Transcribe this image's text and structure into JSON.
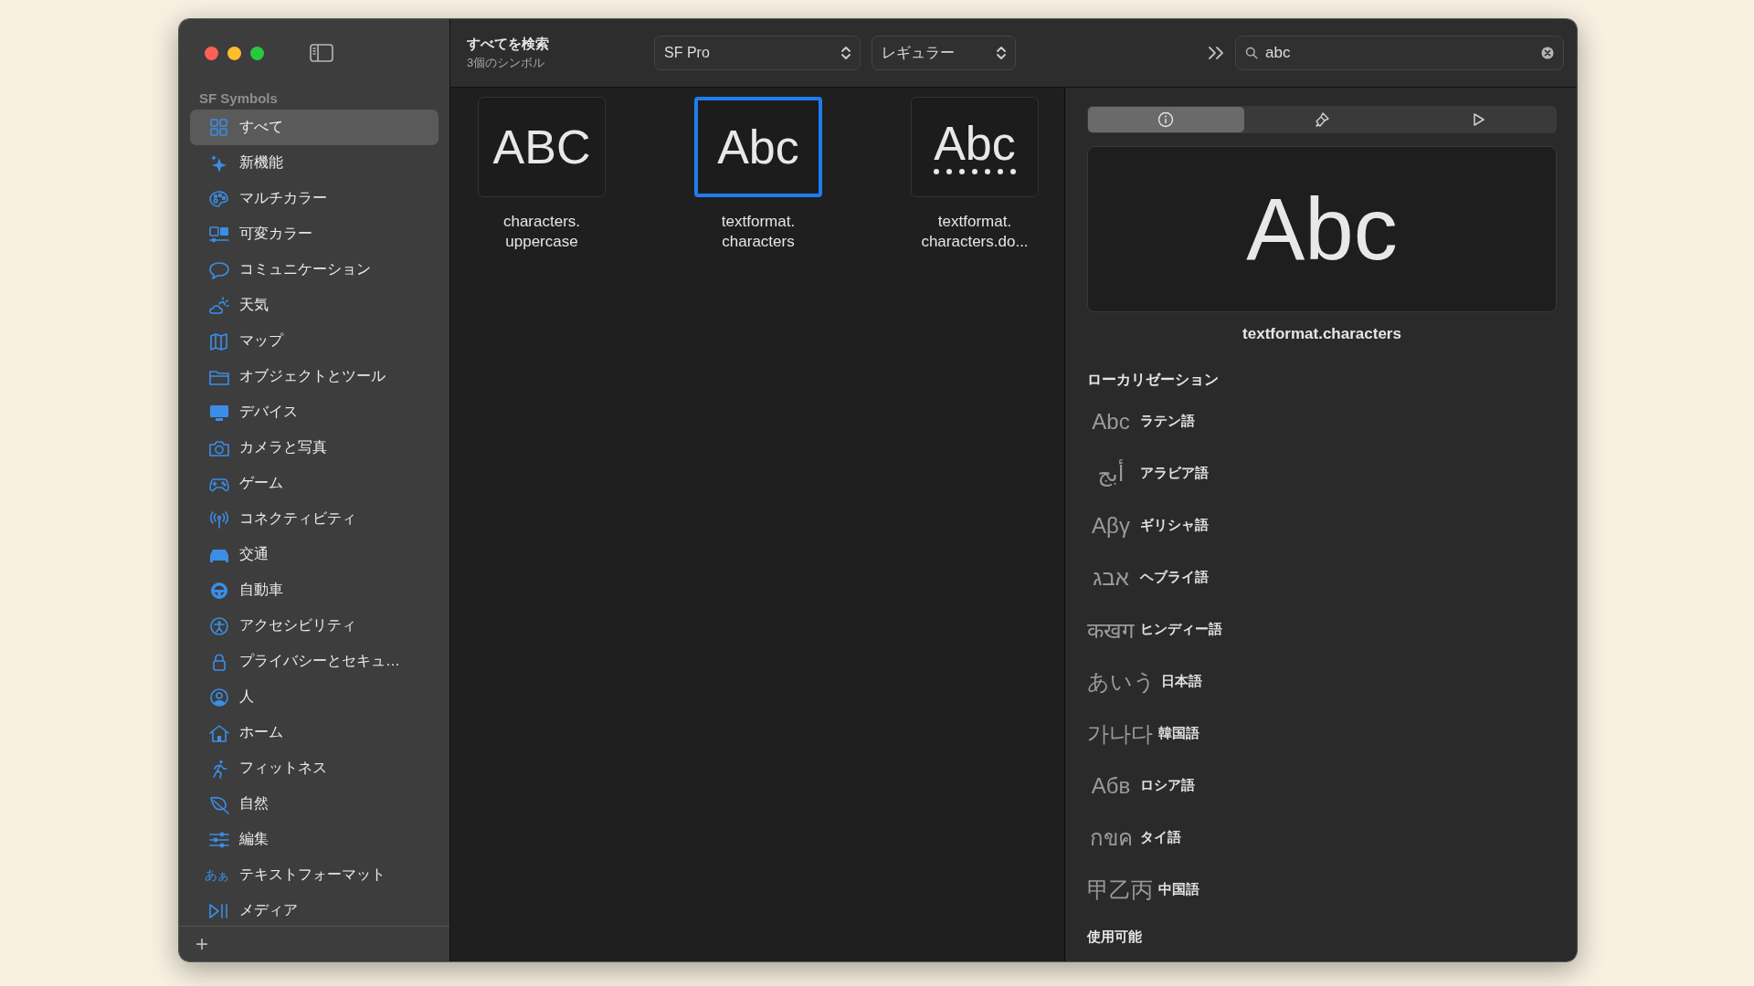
{
  "window": {
    "title": "すべてを検索",
    "subtitle": "3個のシンボル"
  },
  "sidebar": {
    "heading": "SF Symbols",
    "items": [
      {
        "label": "すべて",
        "selected": true
      },
      {
        "label": "新機能",
        "selected": false
      },
      {
        "label": "マルチカラー",
        "selected": false
      },
      {
        "label": "可変カラー",
        "selected": false
      },
      {
        "label": "コミュニケーション",
        "selected": false
      },
      {
        "label": "天気",
        "selected": false
      },
      {
        "label": "マップ",
        "selected": false
      },
      {
        "label": "オブジェクトとツール",
        "selected": false
      },
      {
        "label": "デバイス",
        "selected": false
      },
      {
        "label": "カメラと写真",
        "selected": false
      },
      {
        "label": "ゲーム",
        "selected": false
      },
      {
        "label": "コネクティビティ",
        "selected": false
      },
      {
        "label": "交通",
        "selected": false
      },
      {
        "label": "自動車",
        "selected": false
      },
      {
        "label": "アクセシビリティ",
        "selected": false
      },
      {
        "label": "プライバシーとセキュ…",
        "selected": false
      },
      {
        "label": "人",
        "selected": false
      },
      {
        "label": "ホーム",
        "selected": false
      },
      {
        "label": "フィットネス",
        "selected": false
      },
      {
        "label": "自然",
        "selected": false
      },
      {
        "label": "編集",
        "selected": false
      },
      {
        "label": "テキストフォーマット",
        "selected": false,
        "icon_text": "あぁ"
      },
      {
        "label": "メディア",
        "selected": false
      }
    ],
    "add_button": "+"
  },
  "toolbar": {
    "font_popup": "SF Pro",
    "weight_popup": "レギュラー",
    "search": {
      "value": "abc"
    }
  },
  "symbols": [
    {
      "glyph": "ABC",
      "kind": "plain",
      "name": "characters.\nuppercase",
      "selected": false
    },
    {
      "glyph": "Abc",
      "kind": "plain",
      "name": "textformat.\ncharacters",
      "selected": true
    },
    {
      "glyph": "Abc",
      "kind": "dotted",
      "name": "textformat.\ncharacters.do...",
      "selected": false
    }
  ],
  "inspector": {
    "tabs": [
      {
        "kind": "info",
        "selected": true
      },
      {
        "kind": "brush",
        "selected": false
      },
      {
        "kind": "play",
        "selected": false
      }
    ],
    "preview": "Abc",
    "symbol_name": "textformat.characters",
    "section": "ローカリゼーション",
    "localizations": [
      {
        "sample": "Abc",
        "label": "ラテン語"
      },
      {
        "sample": "أبج",
        "label": "アラビア語"
      },
      {
        "sample": "Aβγ",
        "label": "ギリシャ語"
      },
      {
        "sample": "אבג",
        "label": "ヘブライ語"
      },
      {
        "sample": "कखग",
        "label": "ヒンディー語"
      },
      {
        "sample": "あいう",
        "label": "日本語"
      },
      {
        "sample": "가나다",
        "label": "韓国語"
      },
      {
        "sample": "Абв",
        "label": "ロシア語"
      },
      {
        "sample": "กขค",
        "label": "タイ語"
      },
      {
        "sample": "甲乙丙",
        "label": "中国語"
      }
    ],
    "next_section": "使用可能"
  }
}
